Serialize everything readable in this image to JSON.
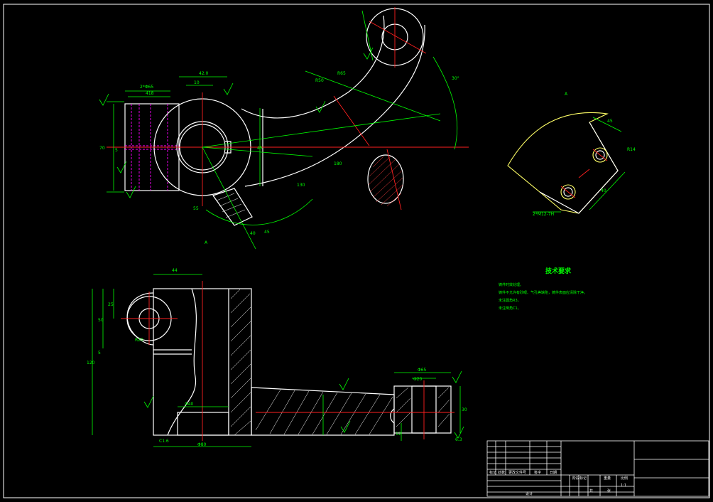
{
  "dimensions": {
    "d_2x065": "2*Φ65",
    "d_418": "418",
    "d_42": "42.0",
    "d_10": "10",
    "d_70": "70",
    "d_5": "5",
    "d_45": "45",
    "d_55": "55",
    "d_180": "180",
    "d_130": "130",
    "d_r50": "R50",
    "d_r65": "R65",
    "d_30deg": "30°",
    "d_45top": "45",
    "d_40": "40",
    "d_m12": "2*M12-7H",
    "d_r14": "R14",
    "d_44": "44",
    "d_50": "50",
    "d_25": "25",
    "d_120": "120",
    "d_r20": "R20",
    "d_5b": "5",
    "d_c1_6": "C1.6",
    "d_080": "Φ80",
    "d_040": "Φ40",
    "d_065": "Φ65",
    "d_020": "Φ20",
    "d_30": "30",
    "d_12": "12",
    "d_6_3": "6.3",
    "d_a": "A"
  },
  "notes": {
    "title": "技术要求",
    "lines": [
      "铸件时效处理。",
      "铸件不允许有砂眼、气孔等缺陷，铸件表面应清除干净。",
      "未注圆角R3。",
      "未注倒角C1。"
    ]
  },
  "titleblock": {
    "labels": [
      "标记",
      "处数",
      "更改文件号",
      "签字",
      "日期"
    ],
    "design": "设计",
    "stage": "阶段标记",
    "weight": "重量",
    "scale": "比例",
    "scale_value": "1:1",
    "sheet_a": "共",
    "sheet_b": "张"
  }
}
